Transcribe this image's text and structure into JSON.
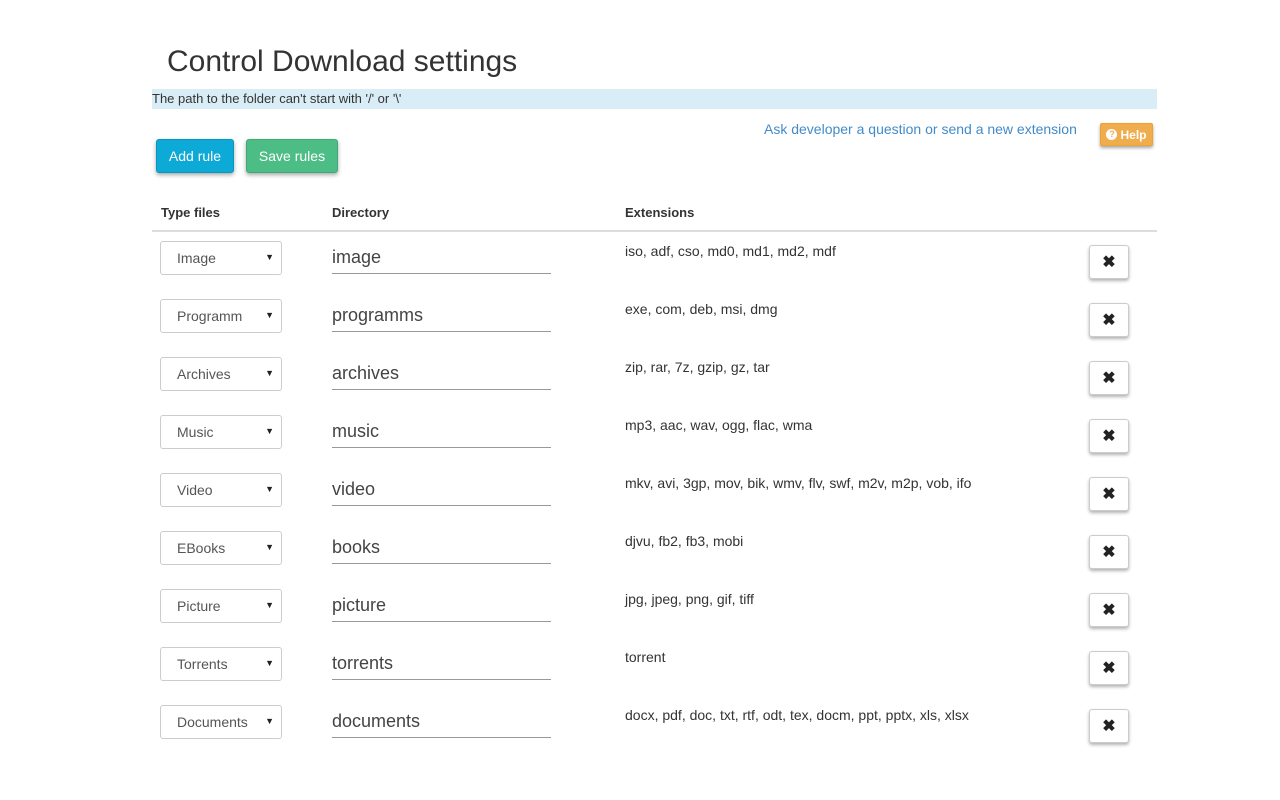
{
  "page": {
    "title": "Control Download settings",
    "notice": "The path to the folder can't start with '/' or '\\'",
    "dev_link": "Ask developer a question or send a new extension",
    "help_label": "Help",
    "help_icon": "question-circle-icon"
  },
  "toolbar": {
    "add_label": "Add rule",
    "save_label": "Save rules"
  },
  "table": {
    "headers": {
      "type": "Type files",
      "directory": "Directory",
      "extensions": "Extensions"
    },
    "rows": [
      {
        "type": "Image",
        "directory": "image",
        "extensions": "iso, adf, cso, md0, md1, md2, mdf"
      },
      {
        "type": "Programm",
        "directory": "programms",
        "extensions": "exe, com, deb, msi, dmg"
      },
      {
        "type": "Archives",
        "directory": "archives",
        "extensions": "zip, rar, 7z, gzip, gz, tar"
      },
      {
        "type": "Music",
        "directory": "music",
        "extensions": "mp3, aac, wav, ogg, flac, wma"
      },
      {
        "type": "Video",
        "directory": "video",
        "extensions": "mkv, avi, 3gp, mov, bik, wmv, flv, swf, m2v, m2p, vob, ifo"
      },
      {
        "type": "EBooks",
        "directory": "books",
        "extensions": "djvu, fb2, fb3, mobi"
      },
      {
        "type": "Picture",
        "directory": "picture",
        "extensions": "jpg, jpeg, png, gif, tiff"
      },
      {
        "type": "Torrents",
        "directory": "torrents",
        "extensions": "torrent"
      },
      {
        "type": "Documents",
        "directory": "documents",
        "extensions": "docx, pdf, doc, txt, rtf, odt, tex, docm, ppt, pptx, xls, xlsx"
      }
    ],
    "remove_icon": "close-icon",
    "remove_glyph": "✖",
    "select_arrow": "▼"
  },
  "colors": {
    "notice_bg": "#d9edf7",
    "link": "#428bca",
    "add_button": "#0eaad7",
    "save_button": "#4dbd86",
    "help_button": "#f0ad4e"
  }
}
